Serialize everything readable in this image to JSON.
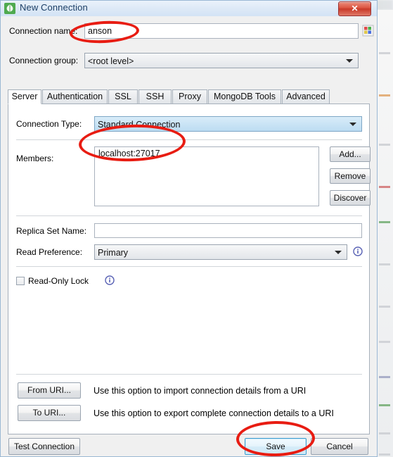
{
  "window": {
    "title": "New Connection",
    "icon": "mongodb-leaf-icon",
    "close_label": "✕"
  },
  "form": {
    "connection_name": {
      "label": "Connection name:",
      "value": "anson",
      "placeholder": "",
      "palette_button_icon": "color-palette-icon"
    },
    "connection_group": {
      "label": "Connection group:",
      "value": "<root level>",
      "options": [
        "<root level>"
      ]
    }
  },
  "tabs": [
    {
      "label": "Server",
      "active": true
    },
    {
      "label": "Authentication",
      "active": false
    },
    {
      "label": "SSL",
      "active": false
    },
    {
      "label": "SSH",
      "active": false
    },
    {
      "label": "Proxy",
      "active": false
    },
    {
      "label": "MongoDB Tools",
      "active": false
    },
    {
      "label": "Advanced",
      "active": false
    }
  ],
  "server_tab": {
    "connection_type": {
      "label": "Connection Type:",
      "value": "Standard Connection",
      "options": [
        "Standard Connection"
      ]
    },
    "members": {
      "label": "Members:",
      "items": [
        "localhost:27017"
      ],
      "buttons": [
        {
          "label": "Add...",
          "name": "add-member-button"
        },
        {
          "label": "Remove",
          "name": "remove-member-button"
        },
        {
          "label": "Discover",
          "name": "discover-members-button"
        }
      ]
    },
    "replica_set_name": {
      "label": "Replica Set Name:",
      "value": "",
      "placeholder": ""
    },
    "read_preference": {
      "label": "Read Preference:",
      "value": "Primary",
      "options": [
        "Primary"
      ],
      "info_icon": "info-icon"
    },
    "read_only_lock": {
      "label": "Read-Only Lock",
      "checked": false,
      "info_icon": "info-icon"
    },
    "uri": [
      {
        "button": "From URI...",
        "description": "Use this option to import connection details from a URI"
      },
      {
        "button": "To URI...",
        "description": "Use this option to export complete connection details to a URI"
      }
    ]
  },
  "footer": {
    "test_connection": "Test Connection",
    "save": "Save",
    "cancel": "Cancel"
  },
  "annotations": {
    "color": "#e81c12",
    "marks": [
      "connection-name-value",
      "members-first-item",
      "save-button"
    ]
  }
}
